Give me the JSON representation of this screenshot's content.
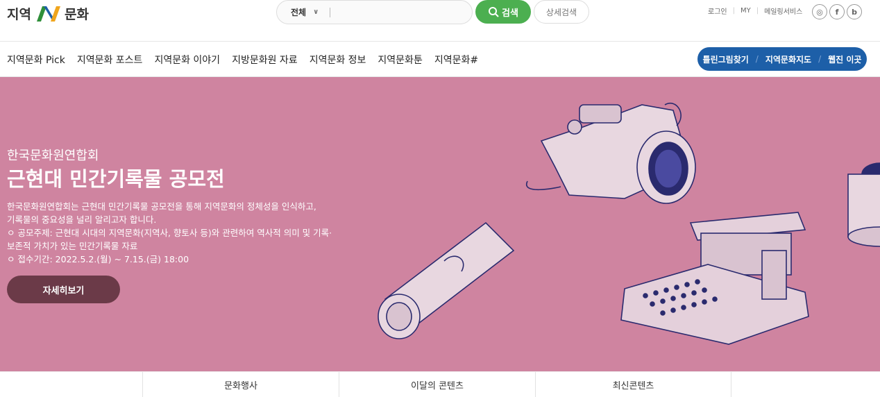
{
  "logo": {
    "left": "지역",
    "right": "문화"
  },
  "search": {
    "scope": "전체",
    "placeholder": "",
    "button": "검색",
    "detail": "상세검색"
  },
  "util": {
    "login": "로그인",
    "my": "MY",
    "mail": "메일링서비스"
  },
  "social": [
    {
      "icon": "instagram-icon",
      "glyph": "◎"
    },
    {
      "icon": "facebook-icon",
      "glyph": "f"
    },
    {
      "icon": "blog-icon",
      "glyph": "b"
    }
  ],
  "nav": {
    "items": [
      "지역문화 Pick",
      "지역문화 포스트",
      "지역문화 이야기",
      "지방문화원 자료",
      "지역문화 정보",
      "지역문화툰",
      "지역문화#"
    ],
    "pill": [
      "틀린그림찾기",
      "지역문화지도",
      "웹진 이곳"
    ]
  },
  "hero": {
    "org": "한국문화원연합회",
    "title": "근현대 민간기록물 공모전",
    "desc": [
      "한국문화원연합회는 근현대 민간기록물 공모전을 통해 지역문화의 정체성을 인식하고,",
      "기록물의 중요성을 널리 알리고자 합니다.",
      "ㅇ 공모주제: 근현대 시대의 지역문화(지역사, 향토사 등)와 관련하여 역사적 의미 및 기록·",
      "보존적 가치가 있는 민간기록물 자료",
      "ㅇ 접수기간: 2022.5.2.(월) ~ 7.15.(금) 18:00"
    ],
    "button": "자세히보기",
    "bg_color": "#cf84a0"
  },
  "tabs": [
    "문화행사",
    "이달의 콘텐츠",
    "최신콘텐츠"
  ]
}
